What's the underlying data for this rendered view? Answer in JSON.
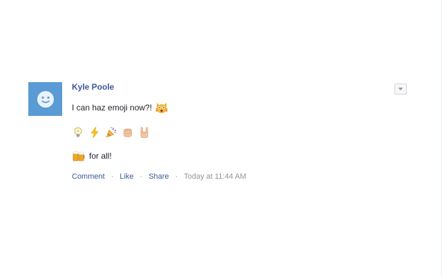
{
  "post": {
    "author": "Kyle Poole",
    "message": "I can haz emoji now?!",
    "message_emoji": "astonished-cat-icon",
    "emoji_row": [
      "light-bulb-icon",
      "lightning-icon",
      "party-popper-icon",
      "raised-fist-icon",
      "horns-hand-icon"
    ],
    "footer_emoji": "beer-mugs-icon",
    "footer_text": "for all!"
  },
  "actions": {
    "comment": "Comment",
    "like": "Like",
    "share": "Share",
    "separator": "·",
    "timestamp": "Today at 11:44 AM"
  },
  "colors": {
    "link": "#3b5998",
    "avatar": "#5b9bd5",
    "muted": "#90949c"
  }
}
